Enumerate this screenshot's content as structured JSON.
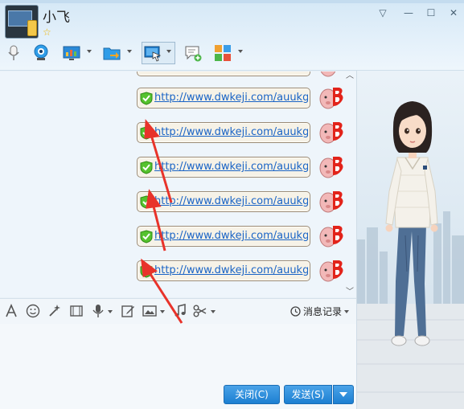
{
  "header": {
    "contact_name": "小飞",
    "window_controls": [
      "▽",
      "—",
      "☐",
      "✕"
    ]
  },
  "toolbar": {
    "icons": [
      "microphone-icon",
      "video-call-icon",
      "screen-share-icon",
      "file-transfer-icon",
      "remote-desktop-icon",
      "add-message-icon",
      "apps-grid-icon"
    ]
  },
  "chat": {
    "messages": [
      {
        "text": "http://www.dwkeji.com/auukgc"
      },
      {
        "text": "http://www.dwkeji.com/auukgc"
      },
      {
        "text": "http://www.dwkeji.com/auukgc"
      },
      {
        "text": "http://www.dwkeji.com/auukgc"
      },
      {
        "text": "http://www.dwkeji.com/auukgc"
      },
      {
        "text": "http://www.dwkeji.com/auukgc"
      }
    ]
  },
  "input_toolbar": {
    "icons": [
      "font-icon",
      "emoji-icon",
      "magic-wand-icon",
      "gif-icon",
      "voice-icon",
      "edit-icon",
      "image-icon",
      "music-icon",
      "scissors-icon"
    ],
    "history_label": "消息记录"
  },
  "buttons": {
    "close_label": "关闭(C)",
    "send_label": "发送(S)"
  },
  "colors": {
    "accent": "#1c7fd2",
    "link": "#1a64c6",
    "annotation": "#e8332a"
  }
}
